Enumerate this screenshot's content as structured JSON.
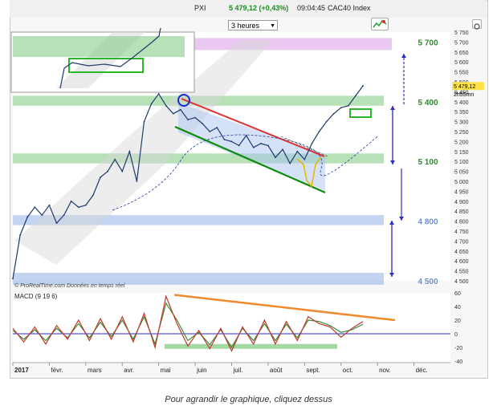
{
  "toolbar": {
    "pxi_label": "PXI",
    "price": "5 479,12 (+0,43%)",
    "time": "09:04:45",
    "instrument": "CAC40 Index",
    "timeframe": "3 heures"
  },
  "watermark": "© ProRealTime.com  Données en temps réel",
  "macd_label": "MACD (9 19 6)",
  "caption": "Pour agrandir le graphique, cliquez dessus",
  "last_price_tag": "5 479,12",
  "countdown_tag": "2h55mn",
  "colors": {
    "price": "#1f3b6e",
    "green_zone": "#7ec87e",
    "blue_zone": "#8fb0e8",
    "purple_zone": "#d79be6",
    "red_line": "#e03030",
    "green_line": "#0c8a0c",
    "orange_line": "#f08a2e",
    "macd_line": "#c0392b",
    "signal_line": "#3a8a3a",
    "zero_line": "#2a2ad8"
  },
  "chart_data": {
    "type": "line",
    "x_labels": [
      "2017",
      "févr.",
      "mars",
      "avr.",
      "mai",
      "juin",
      "juil.",
      "août",
      "sept.",
      "oct.",
      "nov.",
      "déc."
    ],
    "y_ticks": [
      "5 750",
      "5 700",
      "5 650",
      "5 600",
      "5 550",
      "5 500",
      "5 450",
      "5 400",
      "5 350",
      "5 300",
      "5 250",
      "5 200",
      "5 150",
      "5 100",
      "5 050",
      "5 000",
      "4 950",
      "4 900",
      "4 850",
      "4 800",
      "4 750",
      "4 700",
      "4 650",
      "4 600",
      "4 550",
      "4 500"
    ],
    "ylim": [
      4500,
      5750
    ],
    "level_labels": [
      {
        "text": "5 700",
        "value": 5700,
        "color": "#2e8b2e"
      },
      {
        "text": "5 400",
        "value": 5400,
        "color": "#2e8b2e"
      },
      {
        "text": "5 100",
        "value": 5100,
        "color": "#2e8b2e"
      },
      {
        "text": "4 800",
        "value": 4800,
        "color": "#6f8fd0"
      },
      {
        "text": "4 500",
        "value": 4500,
        "color": "#6f8fd0"
      }
    ],
    "zones": [
      {
        "type": "purple",
        "y1": 5660,
        "y2": 5720
      },
      {
        "type": "green",
        "y1": 5380,
        "y2": 5430
      },
      {
        "type": "green",
        "y1": 5090,
        "y2": 5140
      },
      {
        "type": "blue",
        "y1": 4780,
        "y2": 4830
      },
      {
        "type": "blue",
        "y1": 4480,
        "y2": 4540
      }
    ],
    "series": [
      {
        "values_x": [
          0.0,
          0.2,
          0.4,
          0.6,
          0.8,
          1.0,
          1.2,
          1.4,
          1.6,
          1.8,
          2.0,
          2.2,
          2.4,
          2.6,
          2.8,
          3.0,
          3.2,
          3.4,
          3.6,
          3.8,
          4.0,
          4.2,
          4.4,
          4.6,
          4.8,
          5.0,
          5.2,
          5.4,
          5.6,
          5.8,
          6.0,
          6.2,
          6.4,
          6.6,
          6.8,
          7.0,
          7.2,
          7.4,
          7.6,
          7.8,
          8.0,
          8.2,
          8.4,
          8.6,
          8.8,
          9.0,
          9.2,
          9.4,
          9.6
        ],
        "values": [
          4510,
          4730,
          4820,
          4870,
          4830,
          4880,
          4790,
          4830,
          4900,
          4870,
          4880,
          4930,
          5020,
          5050,
          5110,
          5050,
          5150,
          5000,
          5300,
          5390,
          5440,
          5380,
          5340,
          5360,
          5310,
          5320,
          5290,
          5250,
          5270,
          5210,
          5200,
          5180,
          5230,
          5170,
          5190,
          5180,
          5120,
          5160,
          5090,
          5150,
          5110,
          5190,
          5250,
          5300,
          5340,
          5370,
          5380,
          5430,
          5480
        ]
      }
    ],
    "macd": {
      "ylim": [
        -40,
        60
      ],
      "y_ticks": [
        "60",
        "40",
        "20",
        "0",
        "-20",
        "-40"
      ],
      "values_x": [
        0.0,
        0.3,
        0.6,
        0.9,
        1.2,
        1.5,
        1.8,
        2.1,
        2.4,
        2.7,
        3.0,
        3.3,
        3.6,
        3.9,
        4.2,
        4.5,
        4.8,
        5.1,
        5.4,
        5.7,
        6.0,
        6.3,
        6.6,
        6.9,
        7.2,
        7.5,
        7.8,
        8.1,
        8.4,
        8.7,
        9.0,
        9.3,
        9.6
      ],
      "macd_values": [
        8,
        -12,
        10,
        -15,
        12,
        -8,
        20,
        -10,
        22,
        -8,
        25,
        -12,
        30,
        -20,
        55,
        15,
        -18,
        5,
        -22,
        8,
        -25,
        10,
        -15,
        20,
        -15,
        18,
        -10,
        25,
        15,
        10,
        -5,
        8,
        18
      ],
      "signal_values": [
        5,
        -8,
        6,
        -10,
        8,
        -6,
        15,
        -6,
        17,
        -4,
        20,
        -8,
        25,
        -15,
        45,
        20,
        -10,
        2,
        -16,
        6,
        -20,
        8,
        -10,
        15,
        -10,
        14,
        -6,
        20,
        18,
        12,
        2,
        6,
        14
      ]
    }
  }
}
